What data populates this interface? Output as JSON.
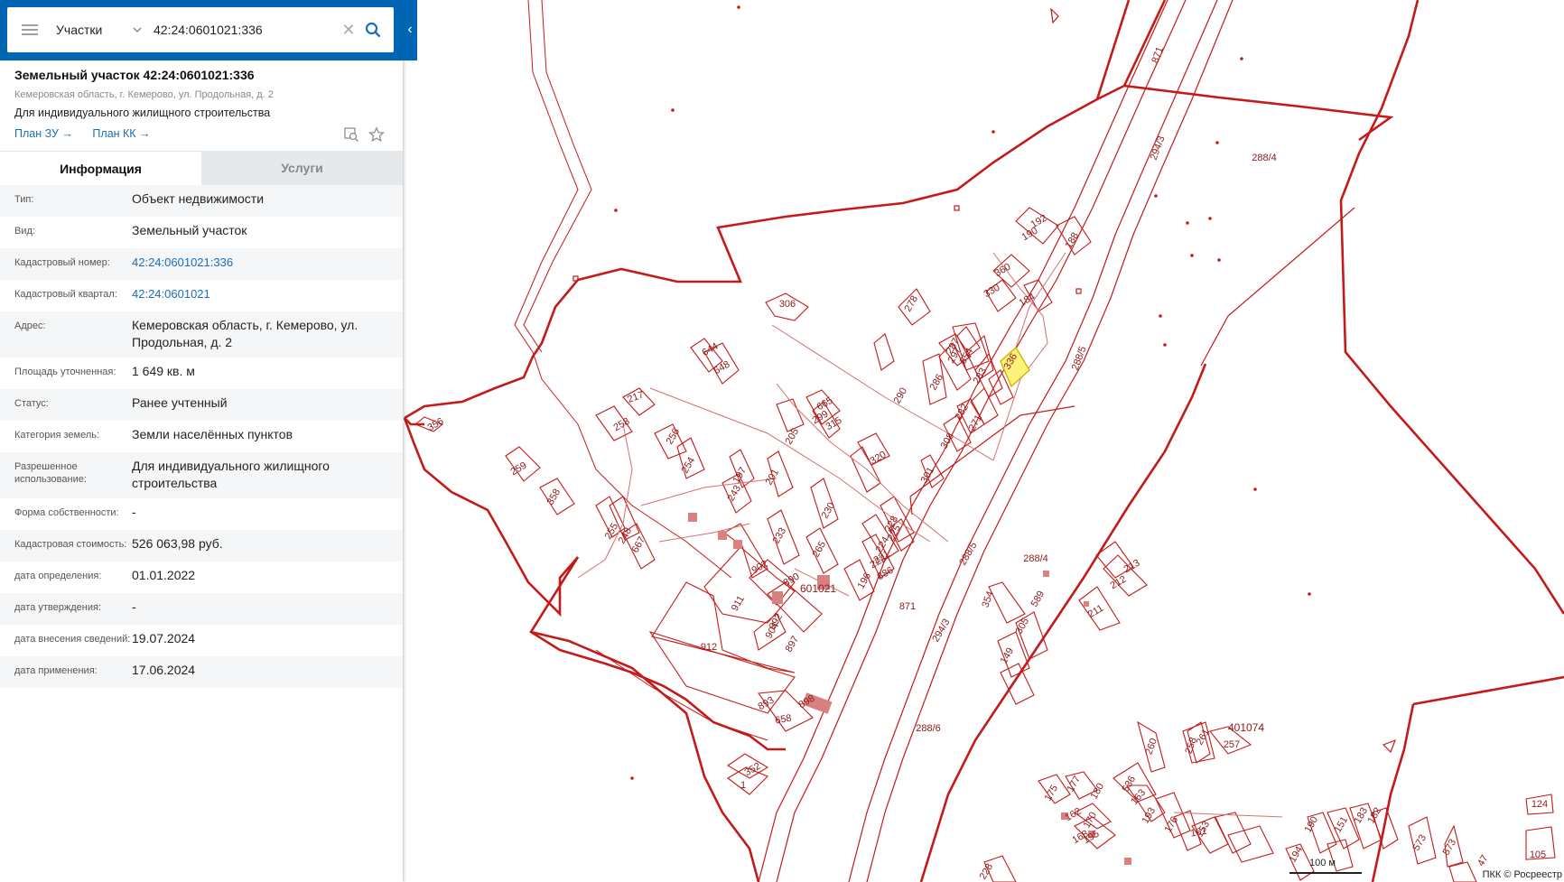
{
  "search": {
    "layer_label": "Участки",
    "query": "42:24:0601021:336",
    "menu_icon": "hamburger-icon",
    "clear_icon": "close-icon",
    "search_icon": "search-icon",
    "collapse_icon": "chevron-left-icon"
  },
  "header": {
    "title": "Земельный участок 42:24:0601021:336",
    "address": "Кемеровская область, г. Кемерово, ул. Продольная, д. 2",
    "use": "Для индивидуального жилищного строительства",
    "plan_zu": "План ЗУ →",
    "plan_kk": "План КК →"
  },
  "tabs": {
    "info": "Информация",
    "services": "Услуги"
  },
  "rows": [
    {
      "label": "Тип:",
      "value": "Объект недвижимости"
    },
    {
      "label": "Вид:",
      "value": "Земельный участок"
    },
    {
      "label": "Кадастровый номер:",
      "value": "42:24:0601021:336"
    },
    {
      "label": "Кадастровый квартал:",
      "value": "42:24:0601021"
    },
    {
      "label": "Адрес:",
      "value": "Кемеровская область, г. Кемерово, ул. Продольная, д. 2"
    },
    {
      "label": "Площадь уточненная:",
      "value": "1 649 кв. м"
    },
    {
      "label": "Статус:",
      "value": "Ранее учтенный"
    },
    {
      "label": "Категория земель:",
      "value": "Земли населённых пунктов"
    },
    {
      "label": "Разрешенное использование:",
      "value": "Для индивидуального жилищного строительства"
    },
    {
      "label": "Форма собственности:",
      "value": "-"
    },
    {
      "label": "Кадастровая стоимость:",
      "value": "526 063,98 руб."
    },
    {
      "label": "дата определения:",
      "value": "01.01.2022"
    },
    {
      "label": "дата утверждения:",
      "value": "-"
    },
    {
      "label": "дата внесения сведений:",
      "value": "19.07.2024"
    },
    {
      "label": "дата применения:",
      "value": "17.06.2024"
    }
  ],
  "map": {
    "labels_parcels": [
      "306",
      "278",
      "192",
      "190",
      "188",
      "360",
      "330",
      "184",
      "297",
      "287",
      "654",
      "283",
      "336",
      "644",
      "648",
      "665",
      "299",
      "315",
      "290",
      "286",
      "282",
      "271",
      "308",
      "217",
      "258",
      "356",
      "205",
      "320",
      "301",
      "256",
      "254",
      "201",
      "197",
      "259",
      "358",
      "243",
      "230",
      "228",
      "225",
      "224",
      "221",
      "222",
      "196",
      "886",
      "255",
      "248",
      "667",
      "233",
      "265",
      "902",
      "890",
      "601021",
      "911",
      "892",
      "904",
      "897",
      "912",
      "893",
      "898",
      "658",
      "352",
      "1",
      "871",
      "871",
      "294/3",
      "294/3",
      "288/5",
      "288/5",
      "288/4",
      "288/4",
      "288/6",
      "354",
      "213",
      "212",
      "211",
      "589",
      "305",
      "149",
      "260",
      "258",
      "261",
      "257",
      "401074",
      "175",
      "177",
      "180",
      "536",
      "163",
      "193",
      "176",
      "153",
      "162",
      "168",
      "170",
      "195",
      "161",
      "194",
      "190",
      "151",
      "183",
      "182",
      "573",
      "573",
      "47",
      "105",
      "124",
      "228",
      "28"
    ],
    "selected_parcel": "336",
    "selected_color": "#fff27a",
    "boundary_color": "#c41a1a"
  },
  "scale_label": "100 м",
  "credits": "ПКК © Росреестр"
}
